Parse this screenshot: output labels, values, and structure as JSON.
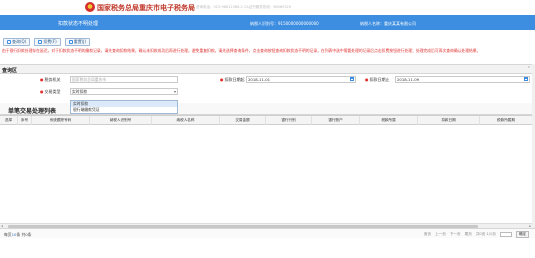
{
  "header": {
    "site_title": "国家税务总局重庆市电子税务局",
    "hotline": "咨询电话：023-96812366-2    CA证书服务热线：96069320",
    "page_title": "扣款状态不明处理",
    "taxpayer_id_label": "纳税人识别号：9150000000000000",
    "taxpayer_name_label": "纳税人名称：重庆某某有限公司"
  },
  "toolbar": {
    "query_label": "查询(Q)",
    "confirm_label": "扣费(F)",
    "reset_label": "重置(J)"
  },
  "notice": "由于银行扣款处理存在延迟，对于扣款状态不明的缴款记录，请先查询扣款结果，确认未扣款成功后再进行处理，避免重复扣款。请先选择查询条件，点击查询按钮查询扣款状态不明的记录，在列表中选中需要处理的记录后点击扣费按钮进行处理；处理完成后可再次查询确认处理结果。",
  "query": {
    "title": "查询区",
    "bank_label": "税务机关",
    "bank_placeholder": "国家税务总局重庆市",
    "start_label": "扣款日期起",
    "start_value": "2018-11-01",
    "end_label": "扣款日期止",
    "end_value": "2018-11-09",
    "type_label": "交易类型",
    "type_value": "实时扣款",
    "type_options": [
      "实时扣款",
      "银行端缴款凭证"
    ]
  },
  "list": {
    "title": "单笔交易处理列表",
    "columns": [
      "选择",
      "序号",
      "系统跟踪号码",
      "纳税人识别号",
      "纳税人名称",
      "交易金额",
      "银行行别",
      "银行账户",
      "税款所属",
      "扣款日期",
      "税款所属期"
    ]
  },
  "footer": {
    "count_prefix": "每页",
    "count_num": "10",
    "count_suffix": "条 共0条",
    "first": "首页",
    "prev": "上一页",
    "next": "下一页",
    "last": "尾页",
    "page_info": "共0页 1/1页",
    "go": "确定"
  }
}
